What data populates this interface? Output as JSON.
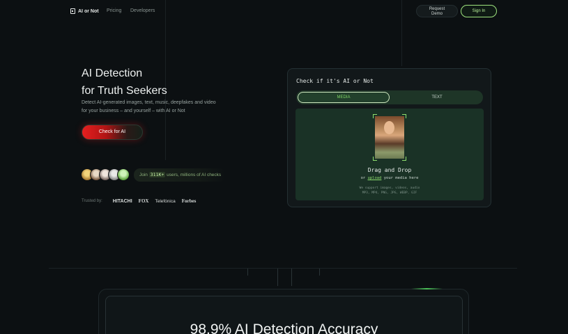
{
  "header": {
    "logo_text": "AI or Not",
    "nav": [
      "Pricing",
      "Developers"
    ],
    "request_demo_line1": "Request",
    "request_demo_line2": "Demo",
    "sign_in": "Sign In"
  },
  "hero": {
    "title_line1": "AI Detection",
    "title_line2": "for Truth Seekers",
    "subtitle": "Detect AI-generated images, text, music, deepfakes and video for your business – and yourself – with AI or Not",
    "cta": "Check for AI",
    "join_prefix": "Join",
    "join_count": "311K+",
    "join_suffix": "users, millions of AI checks",
    "trusted_label": "Trusted by:",
    "brands": [
      "HITACHI",
      "FOX",
      "Telefónica",
      "Forbes"
    ]
  },
  "card": {
    "title": "Check if it's AI or Not",
    "tabs": {
      "media": "MEDIA",
      "text": "TEXT"
    },
    "drag_title": "Drag and Drop",
    "drag_or": "or",
    "drag_upload": "upload",
    "drag_rest": "your media here",
    "support_line1": "We support images, videos, audio",
    "support_line2": "MP3, MP4, PNG, JPG, WEBP, GIF"
  },
  "section": {
    "accuracy_heading": "98.9% AI Detection Accuracy"
  },
  "colors": {
    "background": "#0c1012",
    "accent_green": "#8fe06f",
    "cta_red": "#e61f1f"
  }
}
